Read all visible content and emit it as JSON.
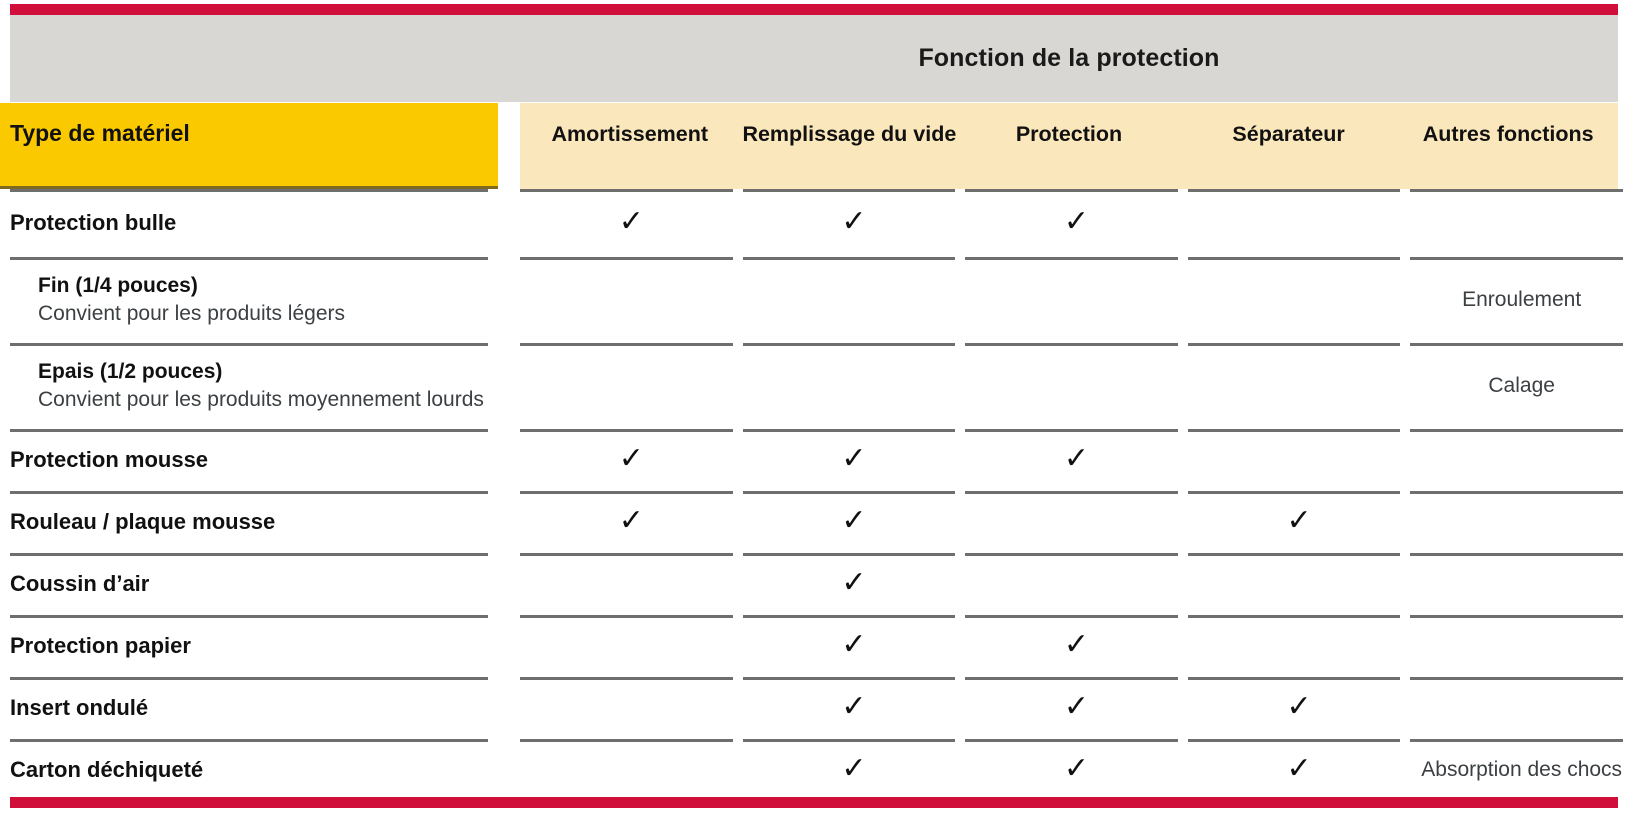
{
  "theme": {
    "red": "#d0103a",
    "grey_band": "#d8d7d3",
    "yellow": "#fbc900",
    "cream": "#fbe7bc",
    "rule": "#6e6e6e",
    "text": "#111111",
    "muted_text": "#3c4043"
  },
  "header": {
    "group_title": "Fonction de la protection",
    "row_header_label": "Type de matériel",
    "columns": [
      "Amortissement",
      "Remplissage du vide",
      "Protection",
      "Séparateur",
      "Autres fonctions"
    ]
  },
  "check_glyph": "✓",
  "rows": [
    {
      "type": "main",
      "label": "Protection bulle",
      "desc": "",
      "cells": [
        "✓",
        "✓",
        "✓",
        "",
        ""
      ]
    },
    {
      "type": "sub",
      "label": "Fin (1/4 pouces)",
      "desc": "Convient pour les produits légers",
      "cells": [
        "",
        "",
        "",
        "",
        "Enroulement"
      ]
    },
    {
      "type": "sub",
      "label": "Epais (1/2 pouces)",
      "desc": "Convient pour les produits moyennement lourds",
      "cells": [
        "",
        "",
        "",
        "",
        "Calage"
      ]
    },
    {
      "type": "main",
      "label": "Protection mousse",
      "desc": "",
      "cells": [
        "✓",
        "✓",
        "✓",
        "",
        ""
      ]
    },
    {
      "type": "main",
      "label": "Rouleau / plaque mousse",
      "desc": "",
      "cells": [
        "✓",
        "✓",
        "",
        "✓",
        ""
      ]
    },
    {
      "type": "main",
      "label": "Coussin d’air",
      "desc": "",
      "cells": [
        "",
        "✓",
        "",
        "",
        ""
      ]
    },
    {
      "type": "main",
      "label": "Protection papier",
      "desc": "",
      "cells": [
        "",
        "✓",
        "✓",
        "",
        ""
      ]
    },
    {
      "type": "main",
      "label": "Insert ondulé",
      "desc": "",
      "cells": [
        "",
        "✓",
        "✓",
        "✓",
        ""
      ]
    },
    {
      "type": "main",
      "label": "Carton déchiqueté",
      "desc": "",
      "cells": [
        "",
        "✓",
        "✓",
        "✓",
        "Absorption des chocs"
      ]
    }
  ]
}
